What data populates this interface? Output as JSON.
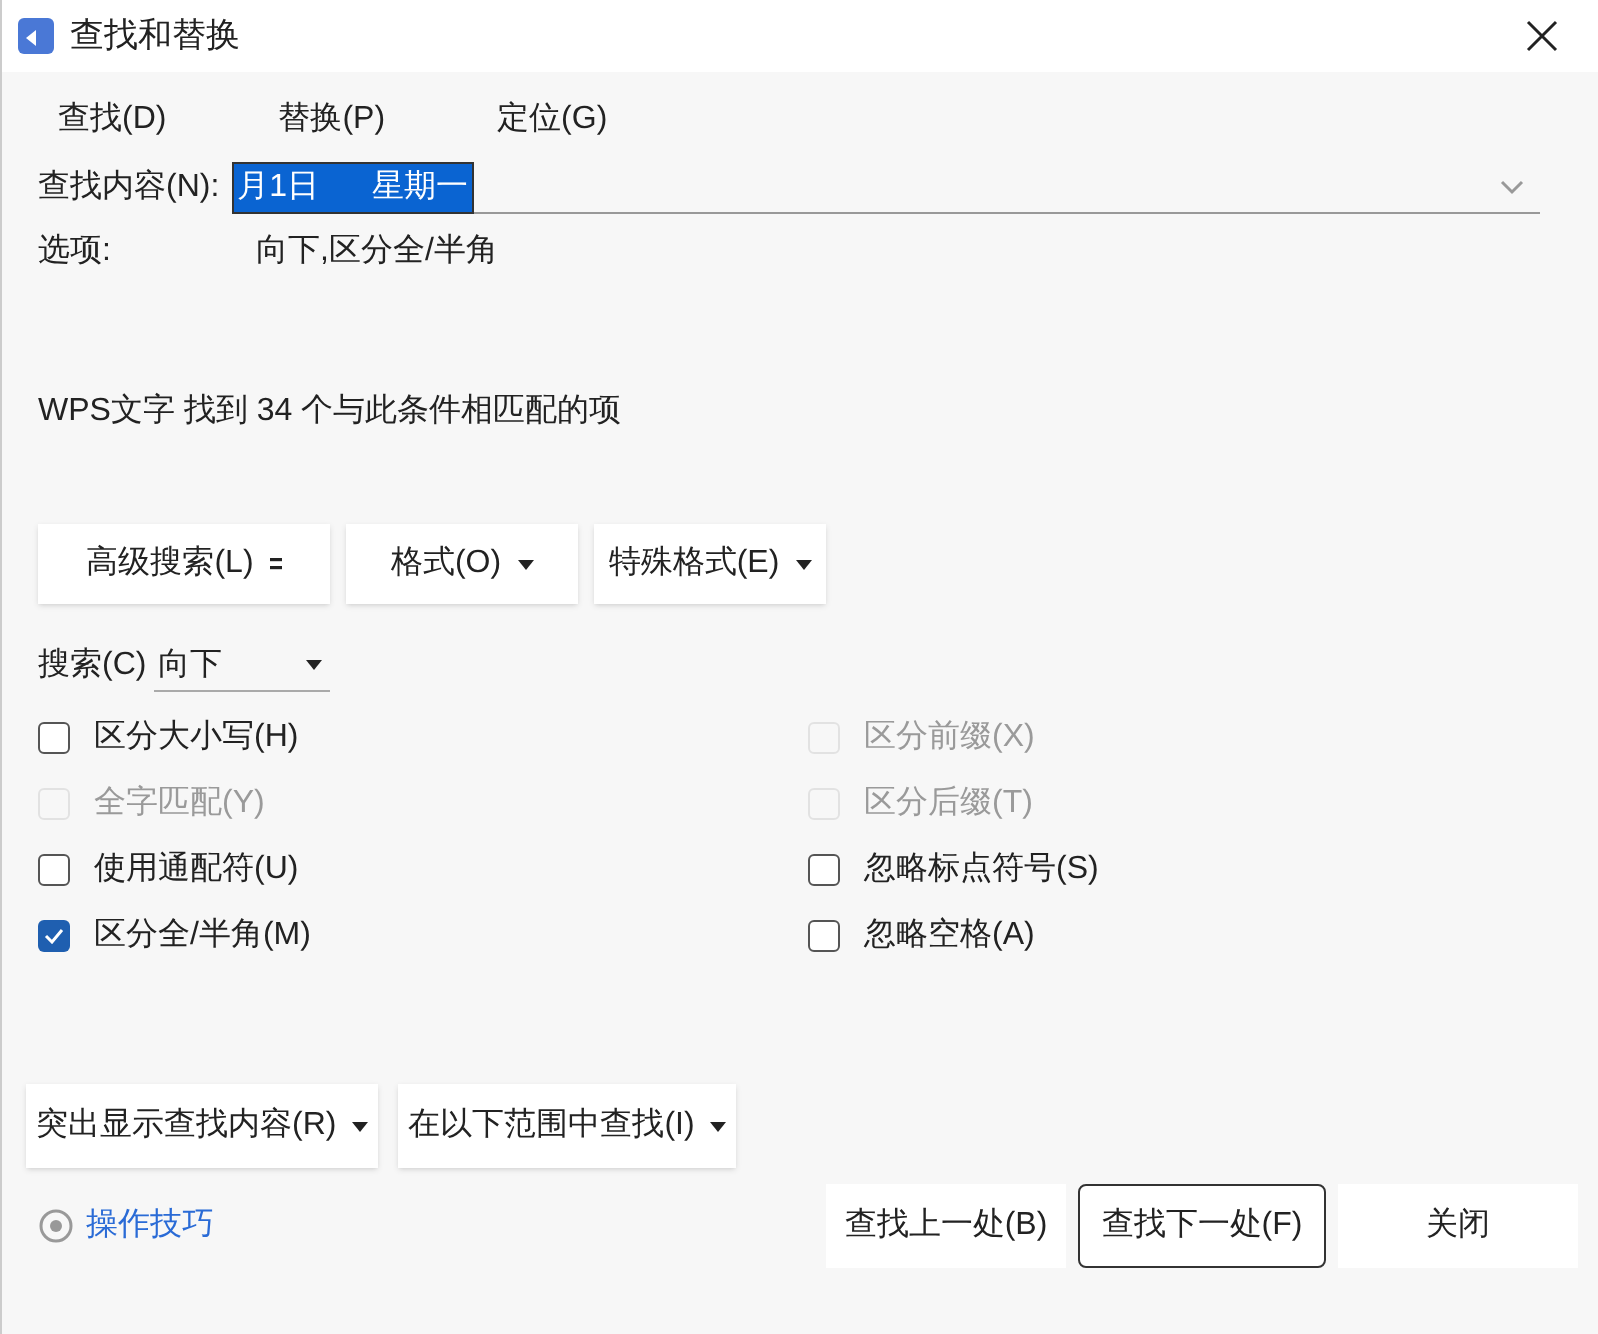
{
  "window": {
    "title": "查找和替换"
  },
  "tabs": [
    {
      "label": "查找(D)"
    },
    {
      "label": "替换(P)"
    },
    {
      "label": "定位(G)"
    }
  ],
  "find_field": {
    "label": "查找内容(N):",
    "value": "月1日      星期一"
  },
  "options": {
    "label": "选项:",
    "value": "向下,区分全/半角"
  },
  "message": "WPS文字 找到 34 个与此条件相匹配的项",
  "format_buttons": [
    {
      "label": "高级搜索(L)",
      "kind": "expand"
    },
    {
      "label": "格式(O)",
      "kind": "dropdown"
    },
    {
      "label": "特殊格式(E)",
      "kind": "dropdown"
    }
  ],
  "search": {
    "label": "搜索(C)",
    "value": "向下"
  },
  "checkboxes": [
    {
      "label": "区分大小写(H)",
      "checked": false,
      "disabled": false
    },
    {
      "label": "区分前缀(X)",
      "checked": false,
      "disabled": true
    },
    {
      "label": "全字匹配(Y)",
      "checked": false,
      "disabled": true
    },
    {
      "label": "区分后缀(T)",
      "checked": false,
      "disabled": true
    },
    {
      "label": "使用通配符(U)",
      "checked": false,
      "disabled": false
    },
    {
      "label": "忽略标点符号(S)",
      "checked": false,
      "disabled": false
    },
    {
      "label": "区分全/半角(M)",
      "checked": true,
      "disabled": false
    },
    {
      "label": "忽略空格(A)",
      "checked": false,
      "disabled": false
    }
  ],
  "bottom_dropdowns": [
    "突出显示查找内容(R)",
    "在以下范围中查找(I)"
  ],
  "tip_link": "操作技巧",
  "buttons": [
    {
      "label": "查找上一处(B)",
      "default": false
    },
    {
      "label": "查找下一处(F)",
      "default": true
    },
    {
      "label": "关闭",
      "default": false
    }
  ]
}
